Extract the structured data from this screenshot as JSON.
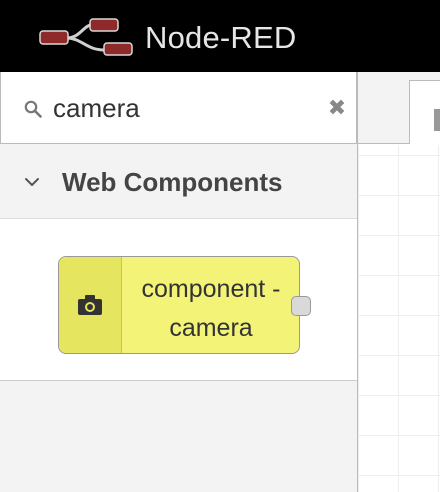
{
  "header": {
    "title": "Node-RED",
    "logo_icon": "node-red-logo",
    "background": "#000000"
  },
  "palette": {
    "search": {
      "value": "camera",
      "search_icon": "search-icon",
      "clear_icon": "close-icon",
      "clear_glyph": "✖"
    },
    "category": {
      "label": "Web Components",
      "expanded": true,
      "chevron_icon": "chevron-down-icon"
    },
    "nodes": [
      {
        "label_line1": "component -",
        "label_line2": "camera",
        "icon": "camera-icon",
        "color": "#f3f377",
        "has_output_port": true
      }
    ]
  },
  "workspace": {
    "grid": true
  }
}
